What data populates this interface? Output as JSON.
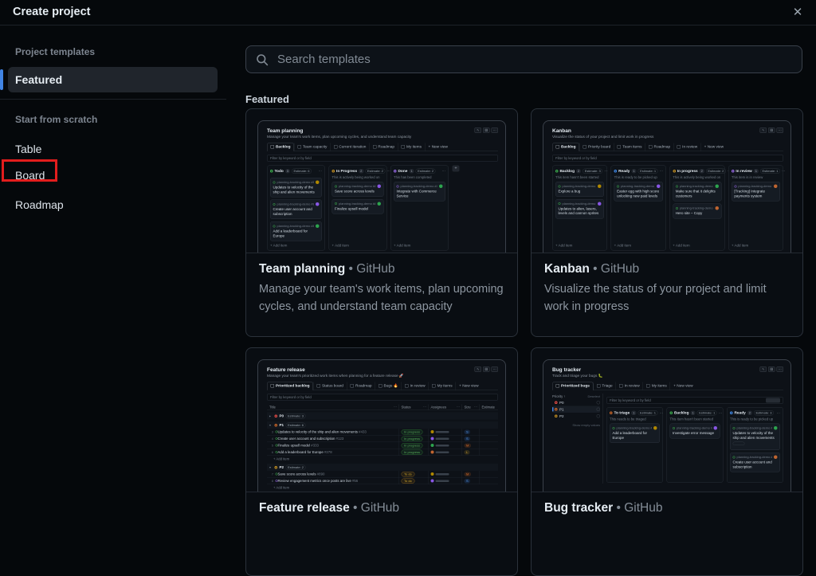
{
  "header": {
    "title": "Create project",
    "close": "✕"
  },
  "sidebar": {
    "templates_label": "Project templates",
    "featured": "Featured",
    "scratch_label": "Start from scratch",
    "scratch_items": [
      "Table",
      "Board",
      "Roadmap"
    ]
  },
  "annotation": {
    "target": "Board",
    "color": "#e31d1d"
  },
  "search": {
    "placeholder": "Search templates"
  },
  "section": {
    "title": "Featured"
  },
  "label_separator": "•",
  "colors": {
    "accent_blue": "#4184e4",
    "green": "#3fb950",
    "yellow": "#d29922",
    "purple": "#a371f7",
    "blue": "#4493f8",
    "red": "#f85149",
    "orange": "#db6d28"
  },
  "cards": [
    {
      "title": "Team planning",
      "owner": "GitHub",
      "description": "Manage your team's work items, plan upcoming cycles, and understand team capacity",
      "preview": {
        "kind": "board",
        "title": "Team planning",
        "subtitle": "Manage your team's work items, plan upcoming cycles, and understand team capacity",
        "tabs": [
          "Backlog",
          "Team capacity",
          "Current iteration",
          "Roadmap",
          "My items"
        ],
        "new_view": "+ New view",
        "filter": "Filter by keyword or by field",
        "plus_button": "+",
        "columns": [
          {
            "name": "Todo",
            "color": "green",
            "count": "3",
            "estimate": "Estimate: 6",
            "subtitle": "This item hasn't been started",
            "footer": "+ Add item",
            "cards": [
              {
                "meta": "planning-tracking-demo #853",
                "title": "Updates to velocity of the ship and alien movements"
              },
              {
                "meta": "planning-tracking-demo #822",
                "title": "Create user account and subscription"
              },
              {
                "meta": "planning-tracking-demo #878",
                "title": "Add a leaderboard for Europe"
              }
            ]
          },
          {
            "name": "In Progress",
            "color": "yellow",
            "count": "2",
            "estimate": "Estimate: 2",
            "subtitle": "This is actively being worked on",
            "footer": "+ Add item",
            "cards": [
              {
                "meta": "planning-tracking-demo #860",
                "title": "Save score across levels"
              },
              {
                "meta": "planning-tracking-demo #861",
                "title": "Finalize upsell model"
              }
            ]
          },
          {
            "name": "Done",
            "color": "purple",
            "count": "1",
            "estimate": "Estimate: 2",
            "subtitle": "This has been completed",
            "footer": "+ Add item",
            "cards": [
              {
                "meta": "planning-tracking-demo #4",
                "title": "Integrate with Commerce Service",
                "icon": "purple"
              }
            ]
          }
        ]
      }
    },
    {
      "title": "Kanban",
      "owner": "GitHub",
      "description": "Visualize the status of your project and limit work in progress",
      "preview": {
        "kind": "board",
        "title": "Kanban",
        "subtitle": "Visualize the status of your project and limit work in progress",
        "tabs": [
          "Backlog",
          "Priority board",
          "Team items",
          "Roadmap",
          "In review"
        ],
        "new_view": "+ New view",
        "filter": "Filter by keyword or by field",
        "columns": [
          {
            "name": "Backlog",
            "color": "green",
            "count": "2",
            "estimate": "Estimate: 3",
            "subtitle": "This item hasn't been started",
            "footer": "+ Add item",
            "cards": [
              {
                "meta": "planning-tracking-demo #780",
                "title": "Explore a bug"
              },
              {
                "meta": "planning-tracking-demo #807",
                "title": "Updates to alien, lasers, levels and cannon sprites"
              }
            ]
          },
          {
            "name": "Ready",
            "color": "blue",
            "count": "1",
            "estimate": "Estimate: 1",
            "subtitle": "This is ready to be picked up",
            "footer": "+ Add item",
            "cards": [
              {
                "meta": "planning-tracking-demo #787",
                "title": "Easter egg with high score unlocking new paid levels"
              }
            ]
          },
          {
            "name": "In progress",
            "color": "yellow",
            "count": "2",
            "estimate": "Estimate: 2",
            "subtitle": "This is actively being worked on",
            "footer": "+ Add item",
            "cards": [
              {
                "meta": "planning-tracking-demo #754",
                "title": "Make sure that it delights customers"
              },
              {
                "meta": "planning-tracking-demo #555",
                "title": "Hero site – Copy"
              }
            ]
          },
          {
            "name": "In review",
            "color": "purple",
            "count": "1",
            "estimate": "Estimate: 1",
            "subtitle": "This item is in review",
            "footer": "+ Add item",
            "cards": [
              {
                "meta": "planning-tracking-demo #757",
                "title": "[Tracking] Integrate payments system",
                "icon": "purple"
              }
            ]
          }
        ]
      }
    },
    {
      "title": "Feature release",
      "owner": "GitHub",
      "preview": {
        "kind": "table",
        "title": "Feature release",
        "subtitle": "Manage your team's prioritized work items when planning for a feature release 🚀",
        "tabs": [
          "Prioritized backlog",
          "Status board",
          "Roadmap",
          "Bugs 🔥",
          "In review",
          "My items"
        ],
        "new_view": "+ New view",
        "filter": "Filter by keyword or by field",
        "headers": [
          "Title",
          "Status",
          "Assignees",
          "Size",
          "Estimate"
        ],
        "groups": [
          {
            "name": "P0",
            "color": "red",
            "collapsed": true,
            "estimate": "Estimate: 3",
            "rows": []
          },
          {
            "name": "P1",
            "color": "orange",
            "estimate": "Estimate: 6",
            "footer": "+ Add item",
            "rows": [
              {
                "num": "3",
                "title": "Updates to velocity of the ship and alien movements",
                "ref": "#433",
                "status": "In progress",
                "status_color": "green",
                "size": "S",
                "size_color": "blue"
              },
              {
                "num": "4",
                "title": "Create user account and subscription",
                "ref": "#123",
                "status": "In progress",
                "status_color": "green",
                "size": "S",
                "size_color": "blue"
              },
              {
                "num": "5",
                "title": "Finalize upsell model",
                "ref": "#333",
                "status": "In progress",
                "status_color": "green",
                "size": "M",
                "size_color": "orange"
              },
              {
                "num": "6",
                "title": "Add a leaderboard for Europe",
                "ref": "#278",
                "status": "In progress",
                "status_color": "green",
                "size": "L",
                "size_color": "yellow"
              }
            ]
          },
          {
            "name": "P2",
            "color": "yellow",
            "estimate": "Estimate: 2",
            "footer": "+ Add item",
            "rows": [
              {
                "num": "7",
                "title": "Save score across levels",
                "ref": "#890",
                "status": "To do",
                "status_color": "orange",
                "size": "M",
                "size_color": "orange"
              },
              {
                "num": "8",
                "title": "Review engagement metrics once posts are live",
                "ref": "#56",
                "status": "To do",
                "status_color": "orange",
                "size": "S",
                "size_color": "blue",
                "icon": "purple"
              }
            ]
          }
        ]
      }
    },
    {
      "title": "Bug tracker",
      "owner": "GitHub",
      "preview": {
        "kind": "split",
        "title": "Bug tracker",
        "subtitle": "Track and triage your bugs 🐛",
        "tabs": [
          "Prioritized bugs",
          "Triage",
          "In review",
          "My items"
        ],
        "new_view": "+ New view",
        "filter": "Filter by keyword or by field",
        "panel": {
          "header": "Priority ↑",
          "action": "Deselect",
          "rows": [
            {
              "label": "P0",
              "color": "red"
            },
            {
              "label": "P1",
              "color": "orange",
              "selected": true
            },
            {
              "label": "P2",
              "color": "yellow"
            }
          ],
          "footer": "Show empty values"
        },
        "columns": [
          {
            "name": "To triage",
            "color": "orange",
            "count": "1",
            "estimate": "Estimate: 1",
            "subtitle": "This needs to be triaged",
            "cards": [
              {
                "meta": "planning-tracking-demo #878",
                "title": "Add a leaderboard for Europe"
              }
            ]
          },
          {
            "name": "Backlog",
            "color": "green",
            "count": "1",
            "estimate": "Estimate: 1",
            "subtitle": "This item hasn't been started",
            "cards": [
              {
                "meta": "planning-tracking-demo #935",
                "title": "Investigate error message"
              }
            ]
          },
          {
            "name": "Ready",
            "color": "blue",
            "count": "2",
            "estimate": "Estimate: 3",
            "subtitle": "This is ready to be picked up",
            "cards": [
              {
                "meta": "planning-tracking-demo #853",
                "title": "Updates to velocity of the ship and alien movements",
                "badge": true
              },
              {
                "meta": "planning-tracking-demo #822",
                "title": "Create user account and subscription"
              }
            ]
          }
        ]
      }
    }
  ]
}
